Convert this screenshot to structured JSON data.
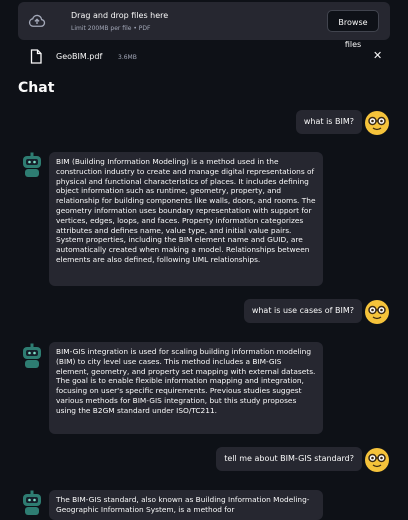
{
  "uploader": {
    "title": "Drag and drop files here",
    "limit": "Limit 200MB per file • PDF",
    "browse_label": "Browse files"
  },
  "file": {
    "name": "GeoBIM.pdf",
    "size": "3.6MB"
  },
  "chat": {
    "heading": "Chat",
    "messages": [
      {
        "role": "user",
        "text": "what is BIM?"
      },
      {
        "role": "assistant",
        "text": "BIM (Building Information Modeling) is a method used in the construction industry to create and manage digital representations of physical and functional characteristics of places. It includes defining object information such as runtime, geometry, property, and relationship for building components like walls, doors, and rooms. The geometry information uses boundary representation with support for vertices, edges, loops, and faces. Property information categorizes attributes and defines name, value type, and initial value pairs. System properties, including the BIM element name and GUID, are automatically created when making a model. Relationships between elements are also defined, following UML relationships."
      },
      {
        "role": "user",
        "text": "what is use cases of BIM?"
      },
      {
        "role": "assistant",
        "text": "BIM-GIS integration is used for scaling building information modeling (BIM) to city level use cases. This method includes a BIM-GIS element, geometry, and property set mapping with external datasets. The goal is to enable flexible information mapping and integration, focusing on user's specific requirements. Previous studies suggest various methods for BIM-GIS integration, but this study proposes using the B2GM standard under ISO/TC211."
      },
      {
        "role": "user",
        "text": "tell me about BIM-GIS standard?"
      },
      {
        "role": "assistant",
        "text": "The BIM-GIS standard, also known as Building Information Modeling-Geographic Information System, is a method for"
      }
    ]
  },
  "icons": {
    "upload": "cloud-upload-icon",
    "file": "file-icon",
    "close": "close-icon",
    "user_avatar": "nerd-face-emoji",
    "assistant_avatar": "robot-avatar"
  },
  "colors": {
    "background": "#0e1117",
    "bubble": "#262730",
    "text": "#fafafa",
    "muted": "#a3a8b8",
    "emoji": "#f5c33b",
    "robot": "#2e7d72"
  }
}
